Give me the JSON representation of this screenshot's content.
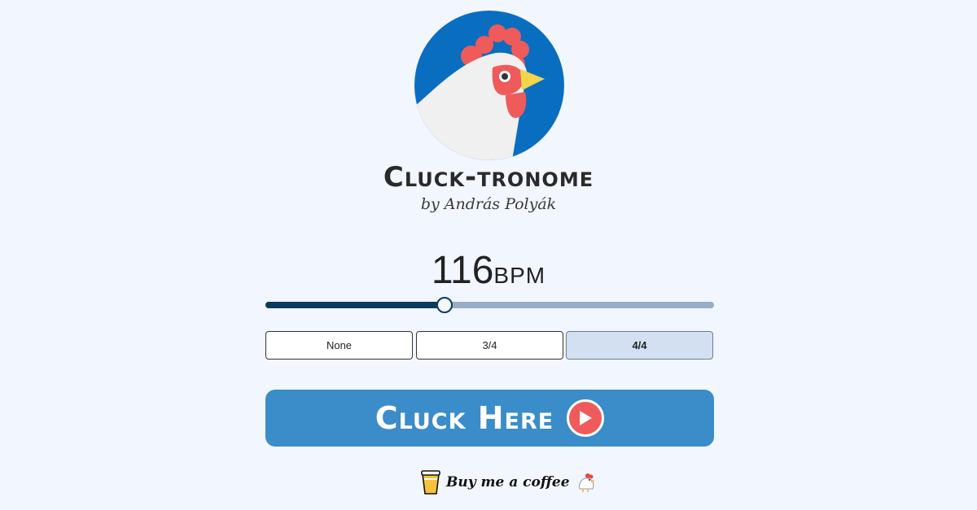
{
  "app": {
    "title": "Cluck-tronome",
    "author": "by András Polyák"
  },
  "tempo": {
    "value": "116",
    "unit": "BPM",
    "slider_fraction": 0.4
  },
  "time_signatures": {
    "options": [
      "None",
      "3/4",
      "4/4"
    ],
    "selected": "4/4"
  },
  "cta": {
    "label": "Cluck Here",
    "icon": "play-icon"
  },
  "donate": {
    "label": "Buy me a coffee",
    "left_icon": "coffee-cup-icon",
    "right_icon": "chicken-icon"
  },
  "colors": {
    "background": "#f2f6ff",
    "logo_blue": "#0a6ec0",
    "comb_red": "#ef5a5a",
    "button_blue": "#3a8dc8",
    "slider_fill": "#0b3a5f",
    "slider_track": "#98aec4",
    "segment_active": "#d2e0f2"
  }
}
